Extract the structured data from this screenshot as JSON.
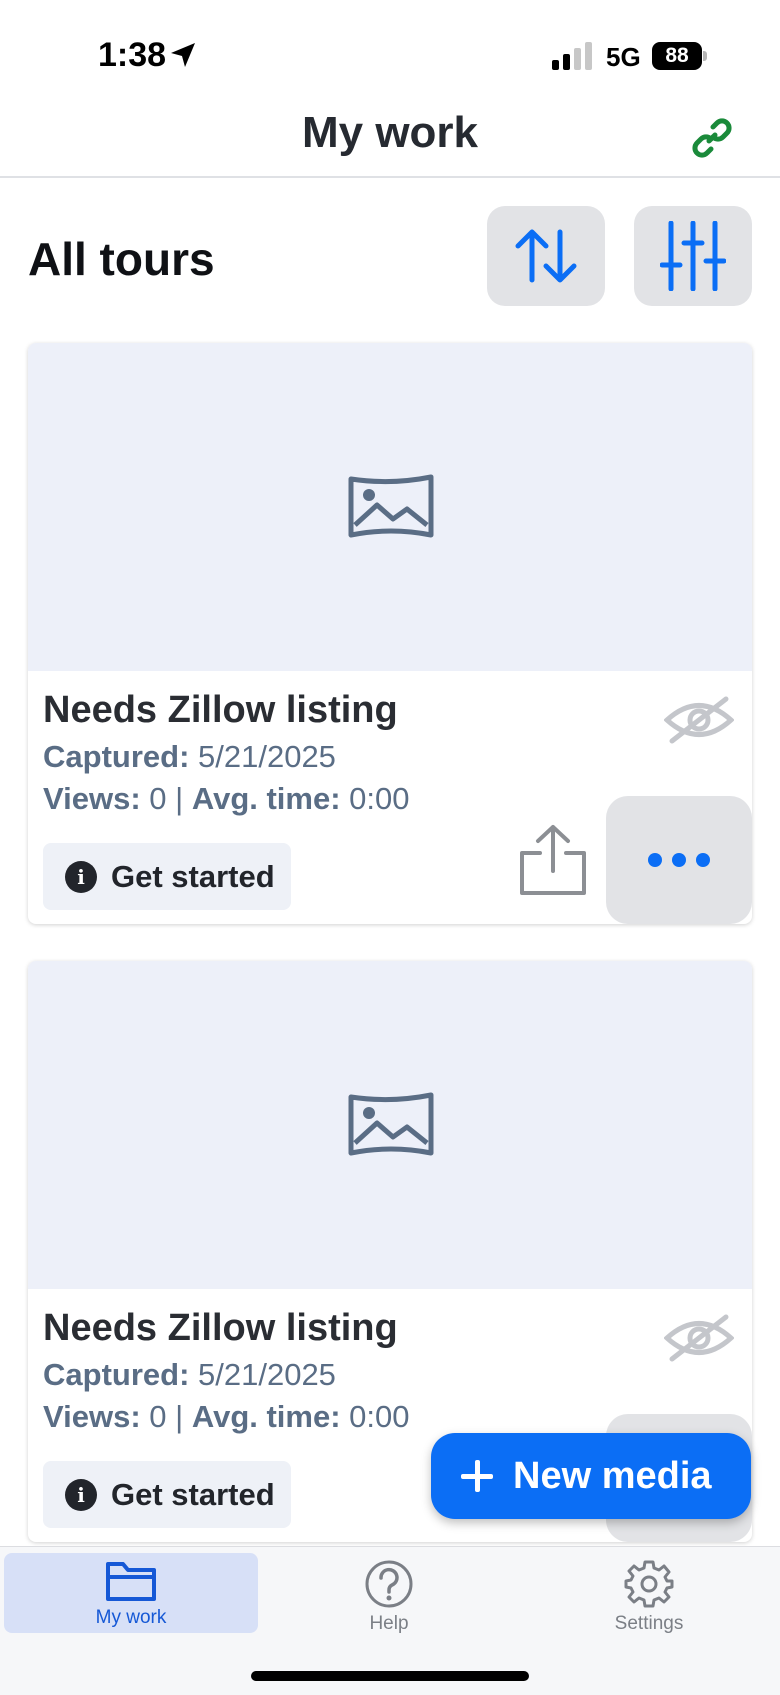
{
  "status_bar": {
    "time": "1:38",
    "network": "5G",
    "battery": "88",
    "location_icon": "location-arrow-icon",
    "signal_icon": "cell-signal-icon"
  },
  "header": {
    "title": "My work",
    "link_icon": "link-icon",
    "link_color": "#1a8a3a"
  },
  "section": {
    "title": "All tours",
    "sort_icon": "sort-arrows-icon",
    "filter_icon": "sliders-icon"
  },
  "tours": [
    {
      "title": "Needs Zillow listing",
      "captured_label": "Captured:",
      "captured_value": "5/21/2025",
      "views_label": "Views:",
      "views_value": "0",
      "separator": "|",
      "avg_label": "Avg. time:",
      "avg_value": "0:00",
      "get_started": "Get started"
    },
    {
      "title": "Needs Zillow listing",
      "captured_label": "Captured:",
      "captured_value": "5/21/2025",
      "views_label": "Views:",
      "views_value": "0",
      "separator": "|",
      "avg_label": "Avg. time:",
      "avg_value": "0:00",
      "get_started": "Get started"
    }
  ],
  "fab": {
    "label": "New media"
  },
  "bottom_nav": {
    "items": [
      {
        "label": "My work",
        "icon": "folder-icon",
        "active": true
      },
      {
        "label": "Help",
        "icon": "help-circle-icon",
        "active": false
      },
      {
        "label": "Settings",
        "icon": "gear-icon",
        "active": false
      }
    ]
  },
  "colors": {
    "accent": "#0b6ef5",
    "text_secondary": "#5a6d85",
    "image_placeholder": "#edf0f9"
  }
}
